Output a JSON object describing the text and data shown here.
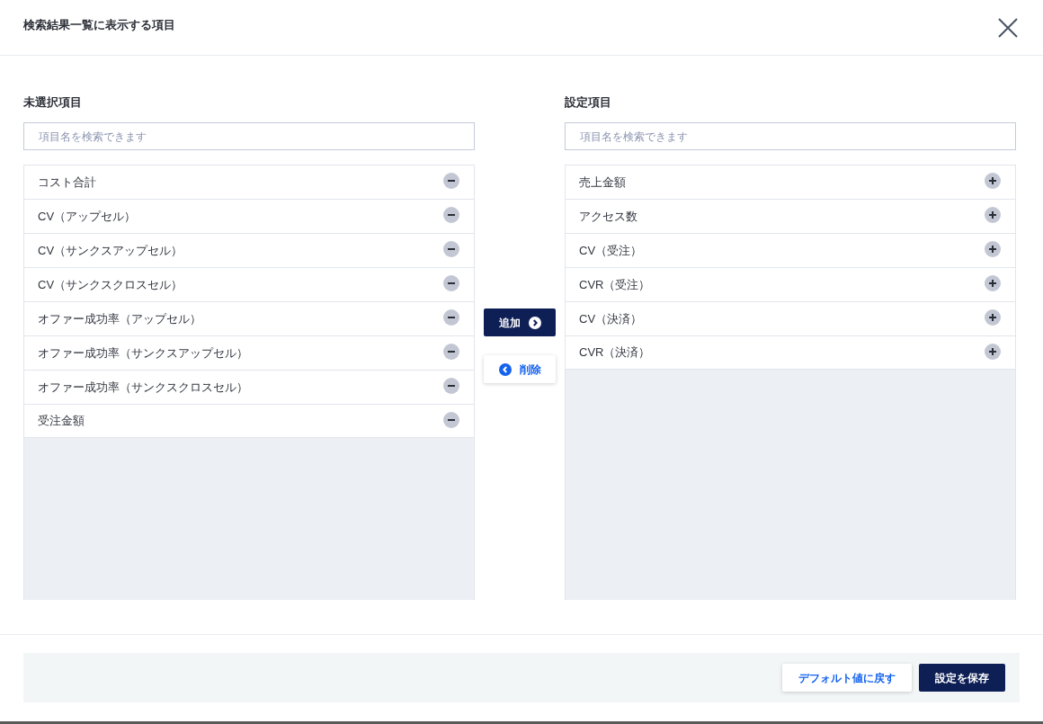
{
  "dialog": {
    "title": "検索結果一覧に表示する項目"
  },
  "unselected": {
    "heading": "未選択項目",
    "search": {
      "placeholder": "項目名を検索できます"
    },
    "items": [
      {
        "label": "コスト合計"
      },
      {
        "label": "CV（アップセル）"
      },
      {
        "label": "CV（サンクスアップセル）"
      },
      {
        "label": "CV（サンクスクロスセル）"
      },
      {
        "label": "オファー成功率（アップセル）"
      },
      {
        "label": "オファー成功率（サンクスアップセル）"
      },
      {
        "label": "オファー成功率（サンクスクロスセル）"
      },
      {
        "label": "受注金額"
      }
    ]
  },
  "transfer_buttons": [
    {
      "label": "追加",
      "kind": "add"
    },
    {
      "label": "削除",
      "kind": "remove"
    }
  ],
  "selected": {
    "heading": "設定項目",
    "search": {
      "placeholder": "項目名を検索できます"
    },
    "items": [
      {
        "label": "売上金額"
      },
      {
        "label": "アクセス数"
      },
      {
        "label": "CV（受注）"
      },
      {
        "label": "CVR（受注）"
      },
      {
        "label": "CV（決済）"
      },
      {
        "label": "CVR（決済）"
      }
    ]
  },
  "footer_buttons": [
    {
      "label": "デフォルト値に戻す",
      "kind": "secondary"
    },
    {
      "label": "設定を保存",
      "kind": "primary"
    }
  ]
}
